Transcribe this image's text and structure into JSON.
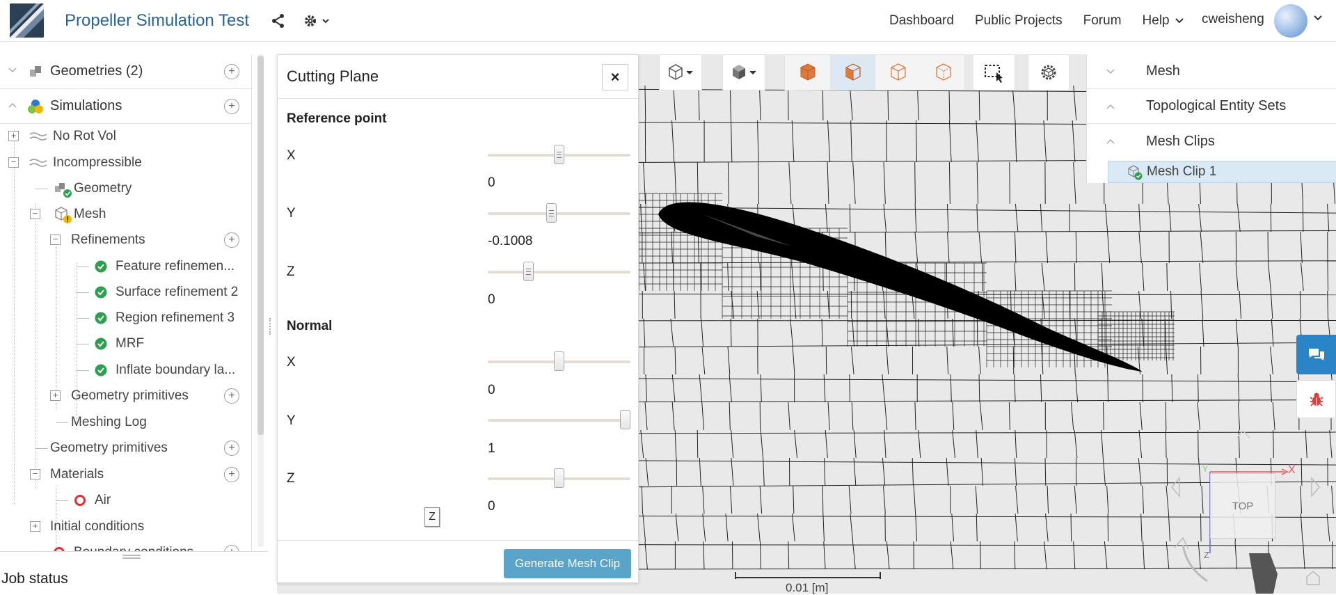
{
  "header": {
    "title": "Propeller Simulation Test",
    "nav": [
      {
        "label": "Dashboard"
      },
      {
        "label": "Public Projects"
      },
      {
        "label": "Forum"
      }
    ],
    "help_label": "Help",
    "username": "cweisheng"
  },
  "tree": {
    "geometries": {
      "label": "Geometries (2)"
    },
    "simulations": {
      "label": "Simulations"
    },
    "no_rot_vol": {
      "label": "No Rot Vol"
    },
    "incompressible": {
      "label": "Incompressible"
    },
    "geometry": {
      "label": "Geometry"
    },
    "mesh": {
      "label": "Mesh"
    },
    "refinements": {
      "label": "Refinements"
    },
    "refinement_items": [
      {
        "label": "Feature refinemen..."
      },
      {
        "label": "Surface refinement 2"
      },
      {
        "label": "Region refinement 3"
      },
      {
        "label": "MRF"
      },
      {
        "label": "Inflate boundary la..."
      }
    ],
    "geometry_primitives_inner": {
      "label": "Geometry primitives"
    },
    "meshing_log": {
      "label": "Meshing Log"
    },
    "geometry_primitives": {
      "label": "Geometry primitives"
    },
    "materials": {
      "label": "Materials"
    },
    "air": {
      "label": "Air"
    },
    "initial_conditions": {
      "label": "Initial conditions"
    },
    "boundary_conditions": {
      "label": "Boundary conditions"
    }
  },
  "job_status": {
    "title": "Job status"
  },
  "cutting_plane": {
    "title": "Cutting Plane",
    "close_label": "×",
    "reference_point": {
      "heading": "Reference point",
      "x": {
        "label": "X",
        "value": "0",
        "slider_fraction": 0.5
      },
      "y": {
        "label": "Y",
        "value": "-0.1008",
        "slider_fraction": 0.44
      },
      "z": {
        "label": "Z",
        "value": "0",
        "slider_fraction": 0.27
      }
    },
    "normal": {
      "heading": "Normal",
      "x": {
        "label": "X",
        "value": "0",
        "slider_fraction": 0.5
      },
      "y": {
        "label": "Y",
        "value": "1",
        "slider_fraction": 1.0
      },
      "z": {
        "label": "Z",
        "value": "0",
        "slider_fraction": 0.5
      }
    },
    "axis_marker": "Z",
    "generate_label": "Generate Mesh Clip"
  },
  "mesh_panel": {
    "mesh": {
      "label": "Mesh"
    },
    "topological": {
      "label": "Topological Entity Sets"
    },
    "mesh_clips": {
      "label": "Mesh Clips"
    },
    "clip_item": {
      "label": "Mesh Clip 1"
    }
  },
  "viewport": {
    "nav_cube_label": "TOP",
    "axis_x": "X",
    "axis_y": "Y",
    "axis_z": "Z",
    "scale_label": "0.01 [m]"
  },
  "colors": {
    "brand_blue": "#2a6496",
    "accent_orange": "#e07a3c",
    "button_blue": "#5aa3c9",
    "check_green": "#2e9e4f",
    "warn_yellow": "#f2b705",
    "air_red": "#e03030"
  }
}
